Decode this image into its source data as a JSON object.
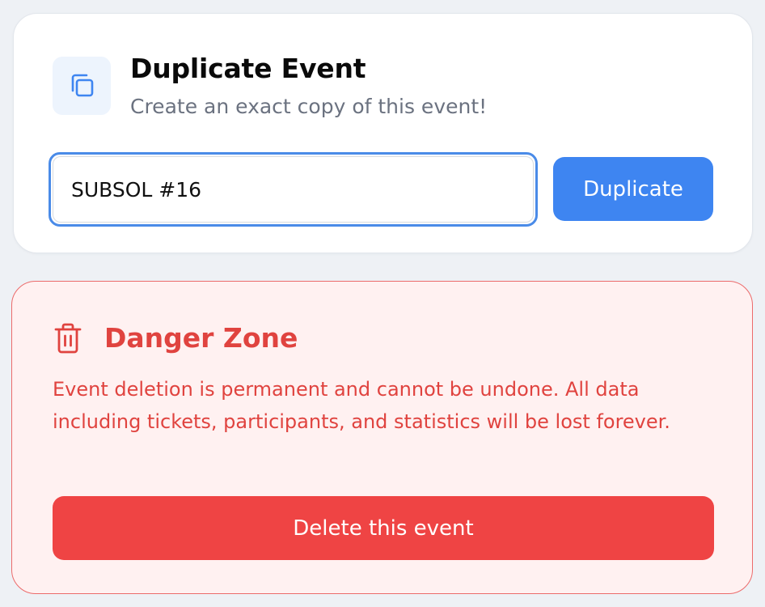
{
  "duplicate_card": {
    "icon": "copy-icon",
    "title": "Duplicate Event",
    "subtitle": "Create an exact copy of this event!",
    "event_name_value": "SUBSOL #16",
    "duplicate_button_label": "Duplicate"
  },
  "danger_zone": {
    "icon": "trash-icon",
    "title": "Danger Zone",
    "description": "Event deletion is permanent and cannot be undone. All data including tickets, participants, and statistics will be lost forever.",
    "delete_button_label": "Delete this event"
  },
  "colors": {
    "primary": "#3e85f1",
    "danger": "#ef4444",
    "danger_text": "#e0433f",
    "danger_background": "#fff1f1",
    "page_background": "#eef1f5"
  }
}
